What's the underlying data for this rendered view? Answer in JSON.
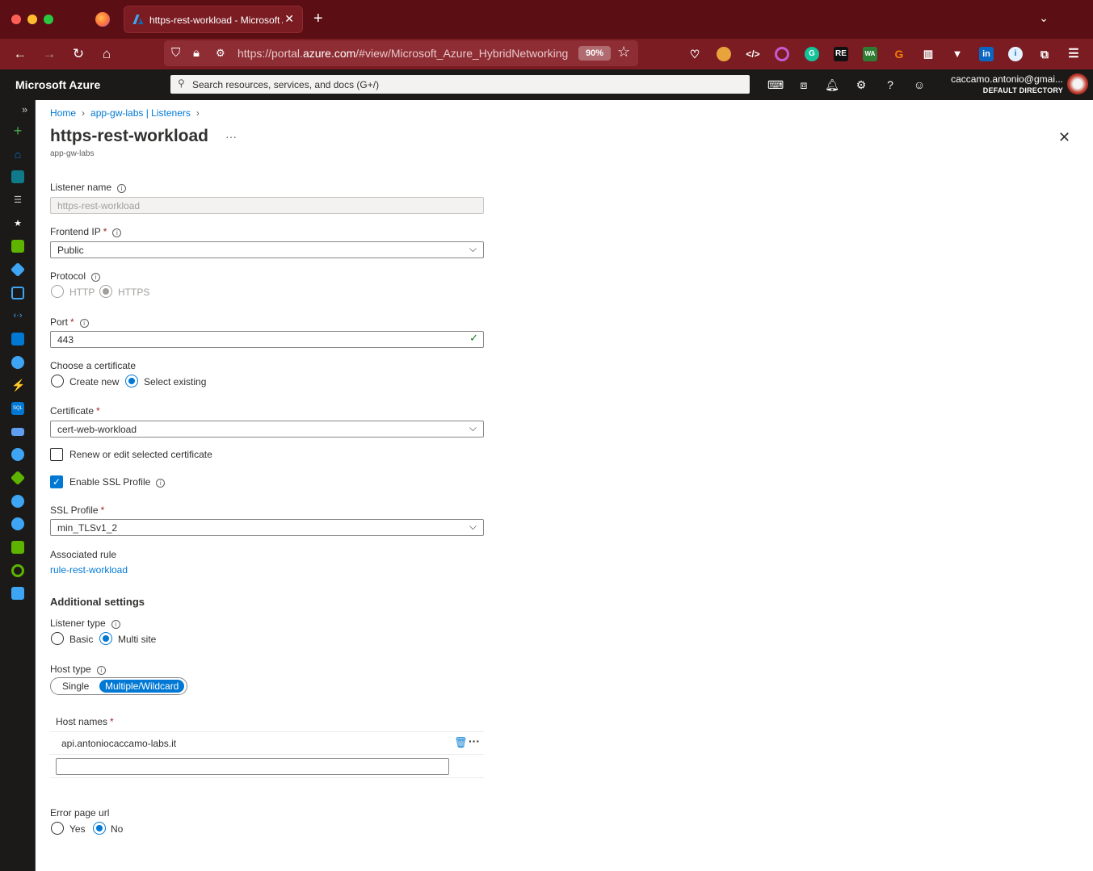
{
  "browser": {
    "tab_title": "https-rest-workload - Microsoft Azure",
    "url_prefix": "https://portal.",
    "url_domain": "azure.com",
    "url_rest": "/#view/Microsoft_Azure_HybridNetworking",
    "zoom": "90%"
  },
  "azure": {
    "brand": "Microsoft Azure",
    "search_placeholder": "Search resources, services, and docs (G+/)",
    "user_name": "caccamo.antonio@gmai...",
    "user_directory": "DEFAULT DIRECTORY"
  },
  "breadcrumb": [
    "Home",
    "app-gw-labs | Listeners"
  ],
  "page": {
    "title": "https-rest-workload",
    "subtitle": "app-gw-labs",
    "ellipsis": "···"
  },
  "form": {
    "listener_name_label": "Listener name",
    "listener_name_value": "https-rest-workload",
    "frontend_ip_label": "Frontend IP",
    "frontend_ip_value": "Public",
    "protocol_label": "Protocol",
    "protocol_options": [
      "HTTP",
      "HTTPS"
    ],
    "port_label": "Port",
    "port_value": "443",
    "cert_choice_label": "Choose a certificate",
    "cert_choice_options": [
      "Create new",
      "Select existing"
    ],
    "certificate_label": "Certificate",
    "certificate_value": "cert-web-workload",
    "renew_label": "Renew or edit selected certificate",
    "ssl_enable_label": "Enable SSL Profile",
    "ssl_profile_label": "SSL Profile",
    "ssl_profile_value": "min_TLSv1_2",
    "assoc_rule_label": "Associated rule",
    "assoc_rule_value": "rule-rest-workload",
    "additional_settings": "Additional settings",
    "listener_type_label": "Listener type",
    "listener_type_options": [
      "Basic",
      "Multi site"
    ],
    "host_type_label": "Host type",
    "host_type_options": [
      "Single",
      "Multiple/Wildcard"
    ],
    "host_names_label": "Host names",
    "host_names": [
      "api.antoniocaccamo-labs.it"
    ],
    "error_page_label": "Error page url",
    "error_page_options": [
      "Yes",
      "No"
    ]
  },
  "colors": {
    "accent": "#0078d4",
    "required": "#a4262c",
    "browser_frame": "#5b0f14",
    "azure_bar": "#1b1a19"
  }
}
